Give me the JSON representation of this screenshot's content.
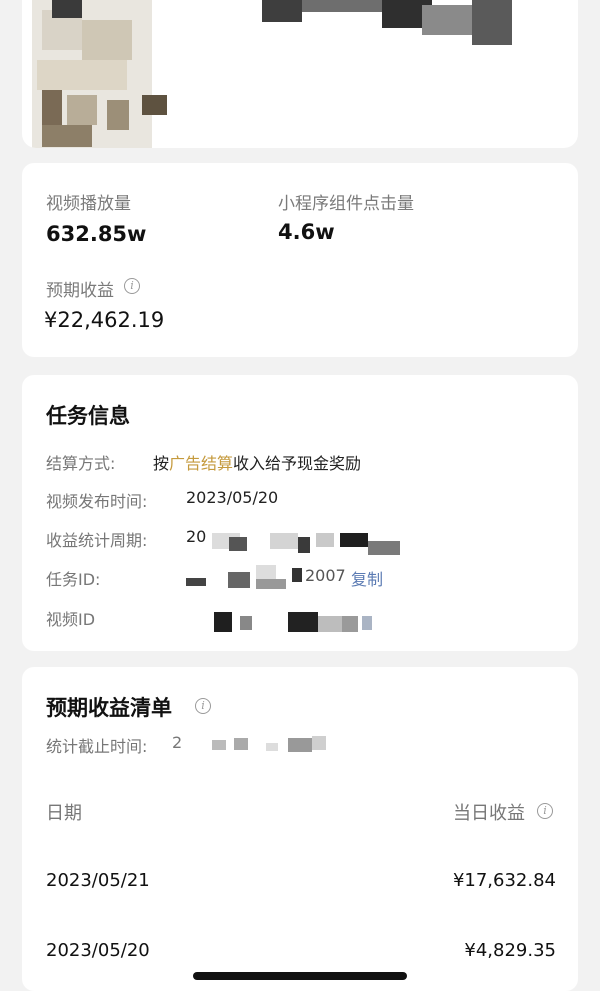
{
  "stats": {
    "video_plays_label": "视频播放量",
    "video_plays_value": "632.85w",
    "miniprogram_clicks_label": "小程序组件点击量",
    "miniprogram_clicks_value": "4.6w",
    "expected_income_label": "预期收益",
    "expected_income_value": "¥22,462.19"
  },
  "task": {
    "title": "任务信息",
    "settlement_label": "结算方式:",
    "settlement_prefix": "按",
    "settlement_highlight": "广告结算",
    "settlement_suffix": "收入给予现金奖励",
    "publish_time_label": "视频发布时间:",
    "publish_time_value": "2023/05/20",
    "income_period_label": "收益统计周期:",
    "income_period_value_visible": "20",
    "task_id_label": "任务ID:",
    "task_id_visible": "2007",
    "copy_label": "复制",
    "video_id_label": "视频ID"
  },
  "income_list": {
    "title": "预期收益清单",
    "cutoff_label": "统计截止时间:",
    "cutoff_value_visible": "2",
    "col_date": "日期",
    "col_daily_income": "当日收益",
    "rows": [
      {
        "date": "2023/05/21",
        "amount": "¥17,632.84"
      },
      {
        "date": "2023/05/20",
        "amount": "¥4,829.35"
      }
    ]
  },
  "colors": {
    "background": "#f2f2f2",
    "card": "#ffffff",
    "highlight": "#c59a3d",
    "link": "#5b7bb3"
  }
}
